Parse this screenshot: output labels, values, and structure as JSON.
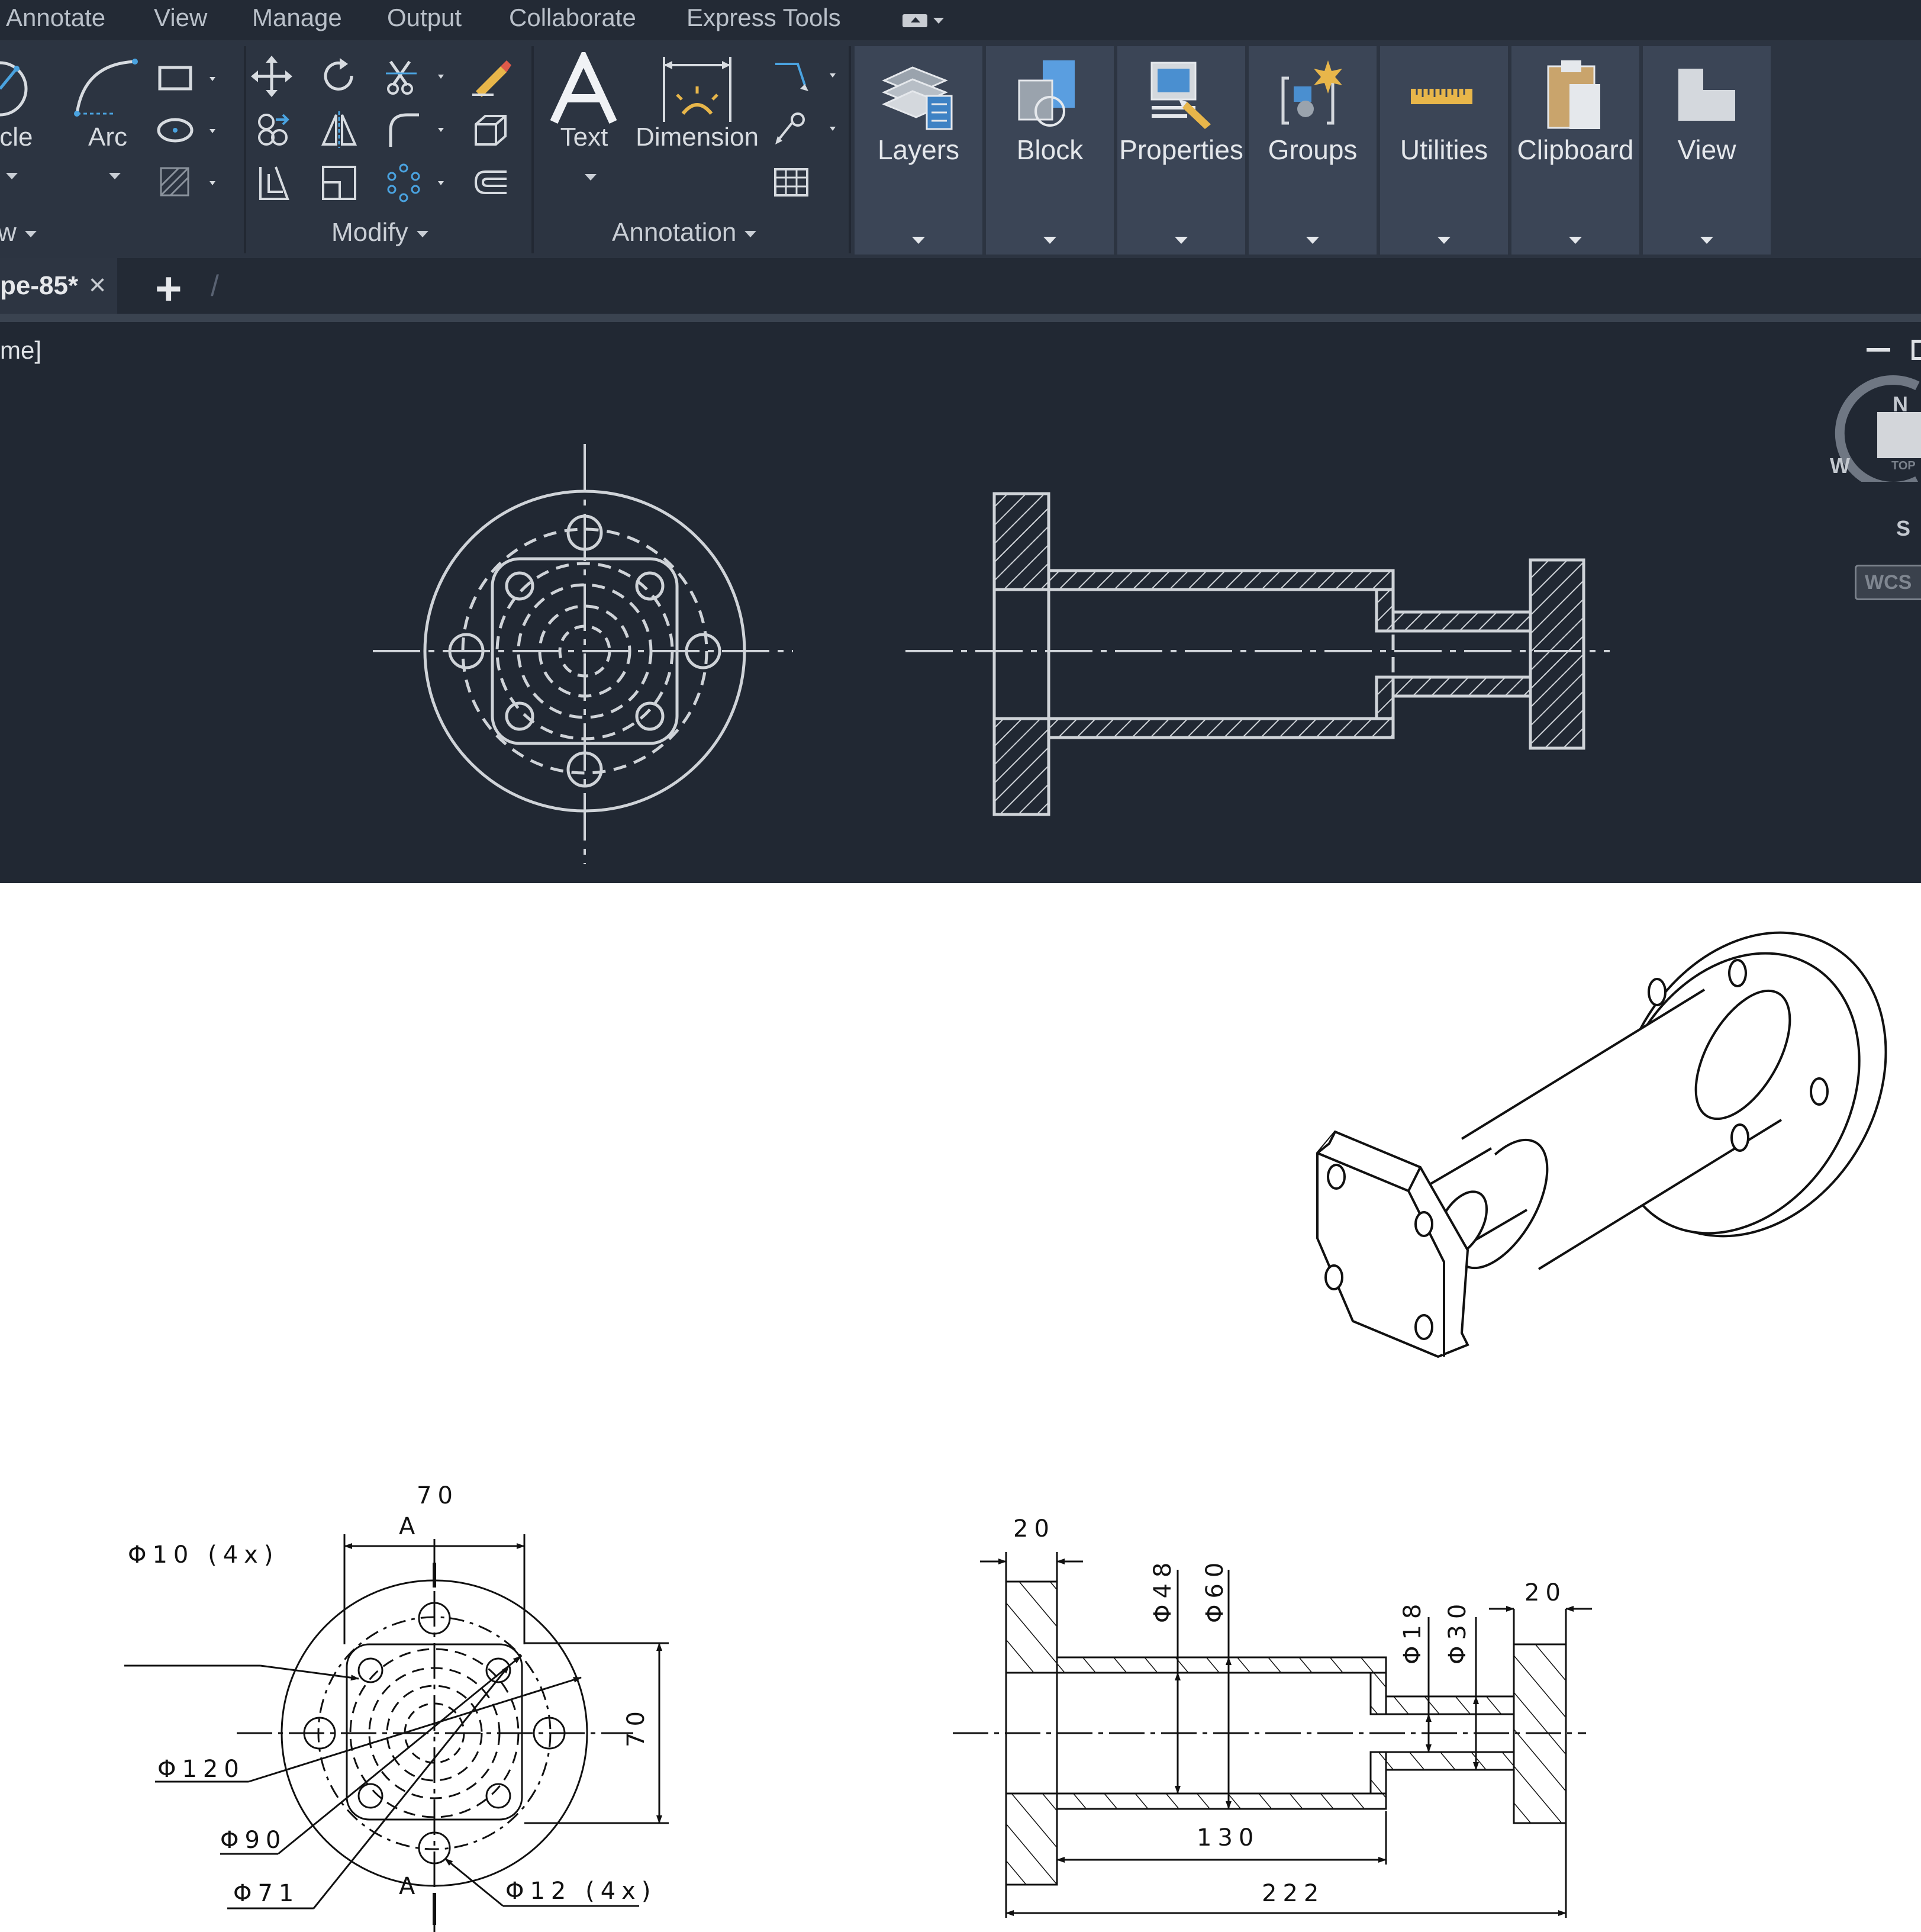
{
  "menubar": {
    "items": [
      "Annotate",
      "View",
      "Manage",
      "Output",
      "Collaborate",
      "Express Tools"
    ]
  },
  "ribbon": {
    "draw_tools": {
      "circle_label": "rcle",
      "arc_label": "Arc"
    },
    "draw_panel_title": "w",
    "modify_panel_title": "Modify",
    "annotation": {
      "text_label": "Text",
      "dimension_label": "Dimension",
      "panel_title": "Annotation"
    },
    "tiles": [
      "Layers",
      "Block",
      "Properties",
      "Groups",
      "Utilities",
      "Clipboard",
      "View"
    ]
  },
  "file_tabs": {
    "active_tab": "pe-85*",
    "close_glyph": "×",
    "new_tab_glyph": "+"
  },
  "viewport": {
    "label": "me]",
    "viewcube": {
      "north": "N",
      "south": "S",
      "west": "W",
      "face": "TOP",
      "ucs": "WCS"
    }
  },
  "drawing": {
    "front_view": {
      "width_top": "70",
      "section_mark_top": "A",
      "section_mark_bottom": "A",
      "holes_small": "Φ10 (4x)",
      "outer_diameter": "Φ120",
      "bolt_circle": "Φ90",
      "square_pattern": "Φ71",
      "holes_large": "Φ12 (4x)",
      "height_right": "70"
    },
    "section_view": {
      "flange_thickness_left": "20",
      "bore_diameter": "Φ48",
      "body_diameter": "Φ60",
      "neck_bore_diameter": "Φ18",
      "neck_diameter": "Φ30",
      "flange_thickness_right": "20",
      "body_length": "130",
      "overall_length": "222"
    }
  },
  "colors": {
    "menubar_bg": "#232a35",
    "ribbon_bg": "#2c3441",
    "tile_bg": "#3b4556",
    "viewport_bg": "#212833",
    "cad_line": "#cfd3d8",
    "accent_yellow": "#e8b64a",
    "accent_blue": "#4aa3e0"
  }
}
